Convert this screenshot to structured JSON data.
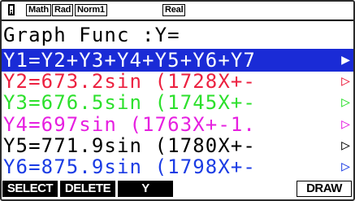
{
  "status": {
    "battery_icon": "battery-icon",
    "modes": [
      "Math",
      "Rad",
      "Norm1"
    ],
    "type": "Real"
  },
  "title": "Graph Func  :Y=",
  "rows": [
    {
      "text": "Y1=Y2+Y3+Y4+Y5+Y6+Y7",
      "arrow": "▶",
      "color": "#ffffff",
      "selected": true
    },
    {
      "text": "Y2=673.2sin (1728X+-",
      "arrow": "▷",
      "color": "#ec2140"
    },
    {
      "text": "Y3=676.5sin (1745X+-",
      "arrow": "▷",
      "color": "#2ce02c"
    },
    {
      "text": "Y4=697sin (1763X+-1.",
      "arrow": "▷",
      "color": "#e61fe0"
    },
    {
      "text": "Y5=771.9sin (1780X+-",
      "arrow": "▷",
      "color": "#000000"
    },
    {
      "text": "Y6=875.9sin (1798X+-",
      "arrow": "▷",
      "color": "#1b3ce4"
    }
  ],
  "fkeys": {
    "f1": "SELECT",
    "f2": "DELETE",
    "f3": "Y",
    "f6": "DRAW"
  },
  "colors": {
    "selection": "#1a2bd6"
  }
}
